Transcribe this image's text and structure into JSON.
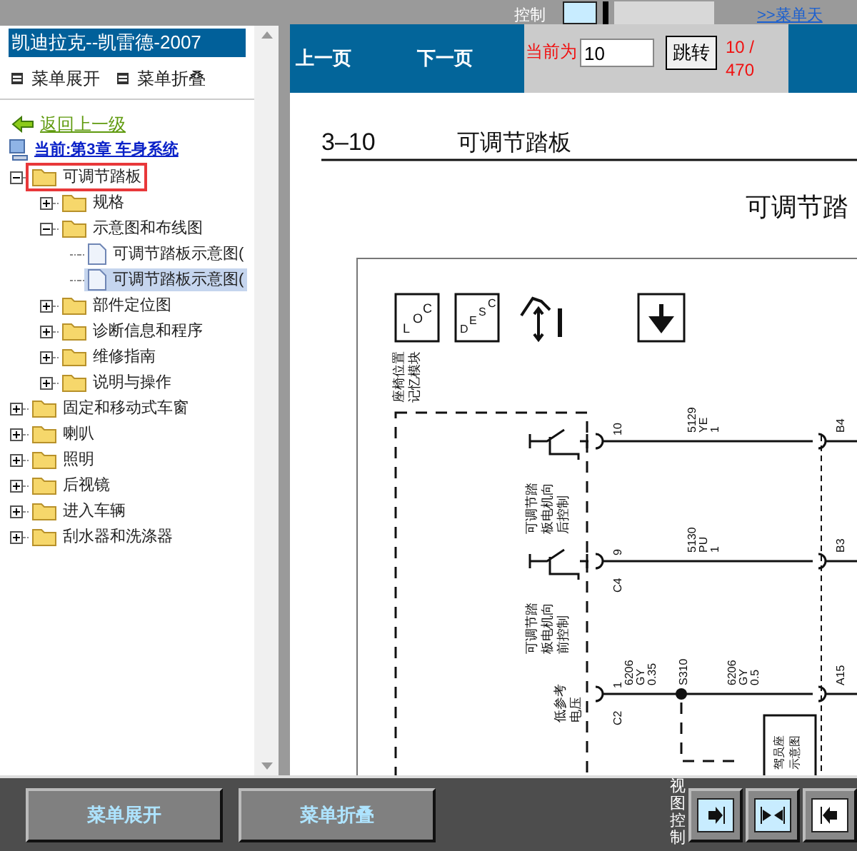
{
  "top_strip": {
    "label": "控制",
    "link": ">>菜单天"
  },
  "sidebar": {
    "title": "凯迪拉克--凯雷德-2007",
    "menu_actions": [
      "菜单展开",
      "菜单折叠"
    ],
    "back_link": "返回上一级",
    "current": "当前:第3章 车身系统",
    "tree": [
      {
        "label": "可调节踏板",
        "kind": "folder",
        "expanded": true,
        "marked": true,
        "selected": false,
        "children": [
          {
            "label": "规格",
            "kind": "folder",
            "expanded": false,
            "marked": false,
            "selected": false
          },
          {
            "label": "示意图和布线图",
            "kind": "folder",
            "expanded": true,
            "marked": false,
            "selected": false,
            "children": [
              {
                "label": "可调节踏板示意图(",
                "kind": "document",
                "marked": false,
                "selected": false
              },
              {
                "label": "可调节踏板示意图(",
                "kind": "document",
                "marked": false,
                "selected": true
              }
            ]
          },
          {
            "label": "部件定位图",
            "kind": "folder",
            "expanded": false,
            "marked": false,
            "selected": false
          },
          {
            "label": "诊断信息和程序",
            "kind": "folder",
            "expanded": false,
            "marked": false,
            "selected": false
          },
          {
            "label": "维修指南",
            "kind": "folder",
            "expanded": false,
            "marked": false,
            "selected": false
          },
          {
            "label": "说明与操作",
            "kind": "folder",
            "expanded": false,
            "marked": false,
            "selected": false
          }
        ]
      },
      {
        "label": "固定和移动式车窗",
        "kind": "folder",
        "expanded": false,
        "marked": false,
        "selected": false
      },
      {
        "label": "喇叭",
        "kind": "folder",
        "expanded": false,
        "marked": false,
        "selected": false
      },
      {
        "label": "照明",
        "kind": "folder",
        "expanded": false,
        "marked": false,
        "selected": false
      },
      {
        "label": "后视镜",
        "kind": "folder",
        "expanded": false,
        "marked": false,
        "selected": false
      },
      {
        "label": "进入车辆",
        "kind": "folder",
        "expanded": false,
        "marked": false,
        "selected": false
      },
      {
        "label": "刮水器和洗涤器",
        "kind": "folder",
        "expanded": false,
        "marked": false,
        "selected": false
      }
    ]
  },
  "toolbar": {
    "prev": "上一页",
    "next": "下一页",
    "current_label": "当前为",
    "page_input": "10",
    "go_button": "跳转",
    "page_count": "10 / 470"
  },
  "document": {
    "section": "3–10",
    "heading": "可调节踏板",
    "diagram_title": "可调节踏",
    "loc_letters": [
      "L",
      "O",
      "C"
    ],
    "desc_letters": [
      "D",
      "E",
      "S",
      "C"
    ],
    "module_label": [
      "座椅位置",
      "记忆模块"
    ],
    "switch_labels": [
      [
        "可调节踏",
        "板电机向",
        "后控制"
      ],
      [
        "可调节踏",
        "板电机向",
        "前控制"
      ]
    ],
    "ref_label": [
      "低参考",
      "电压"
    ],
    "wires": [
      {
        "pin": "10",
        "circuit": [
          "5129",
          "YE",
          "1"
        ],
        "far_pin": "B4"
      },
      {
        "pin": "9",
        "connector": "C4",
        "circuit": [
          "5130",
          "PU",
          "1"
        ],
        "far_pin": "B3"
      },
      {
        "pin": "1",
        "connector": "C2",
        "circuit": [
          "6206",
          "GY",
          "0.35"
        ],
        "far_pin": "A15"
      }
    ],
    "splice": {
      "name": "S310",
      "circuit": [
        "6206",
        "GY",
        "0.5"
      ]
    },
    "ref_box": [
      "驾员座",
      "示意图"
    ]
  },
  "bottom_bar": {
    "buttons": [
      "菜单展开",
      "菜单折叠"
    ],
    "view_label": "视图控制"
  }
}
